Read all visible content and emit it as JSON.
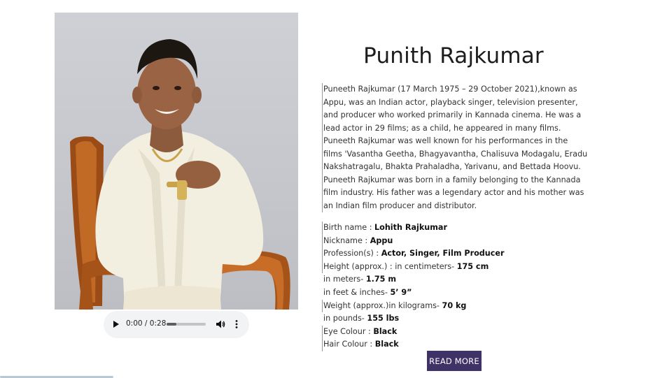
{
  "profile": {
    "name": "Punith Rajkumar",
    "bio": [
      "Puneeth Rajkumar (17 March 1975 – 29 October 2021),known as Appu, was an Indian actor, playback singer, television presenter, and producer who worked primarily in Kannada cinema. He was a lead actor in 29 films; as a child, he appeared in many films.",
      "Puneeth Rajkumar was well known for his performances in the films 'Vasantha Geetha, Bhagyavantha, Chalisuva Modagalu, Eradu Nakshatragalu, Bhakta Prahaladha, Yarivanu, and Bettada Hoovu.",
      "Puneeth Rajkumar was born in a family belonging to the Kannada film industry. His father was a legendary actor and his mother was an Indian film producer and distributor."
    ],
    "facts": [
      {
        "label": "Birth name : ",
        "value": "Lohith Rajkumar"
      },
      {
        "label": "Nickname : ",
        "value": "Appu"
      },
      {
        "label": "Profession(s) : ",
        "value": "Actor, Singer, Film Producer"
      },
      {
        "label": "Height (approx.) : in centimeters- ",
        "value": "175 cm"
      },
      {
        "label": "in meters- ",
        "value": "1.75 m"
      },
      {
        "label": "in feet & inches- ",
        "value": "5’ 9”"
      },
      {
        "label": "Weight (approx.)in kilograms- ",
        "value": "70 kg"
      },
      {
        "label": "in pounds- ",
        "value": "155 lbs"
      },
      {
        "label": "Eye Colour : ",
        "value": "Black"
      },
      {
        "label": "Hair Colour : ",
        "value": "Black"
      }
    ],
    "read_more_label": "READ MORE"
  },
  "audio": {
    "time_display": "0:00 / 0:28",
    "progress_fraction": 0.25,
    "play_icon": "play-icon",
    "volume_icon": "volume-icon",
    "more_icon": "more-vertical-icon"
  },
  "colors": {
    "button_bg": "#3f3267",
    "button_text": "#ffffff",
    "audio_bg": "#f1f3f4"
  }
}
